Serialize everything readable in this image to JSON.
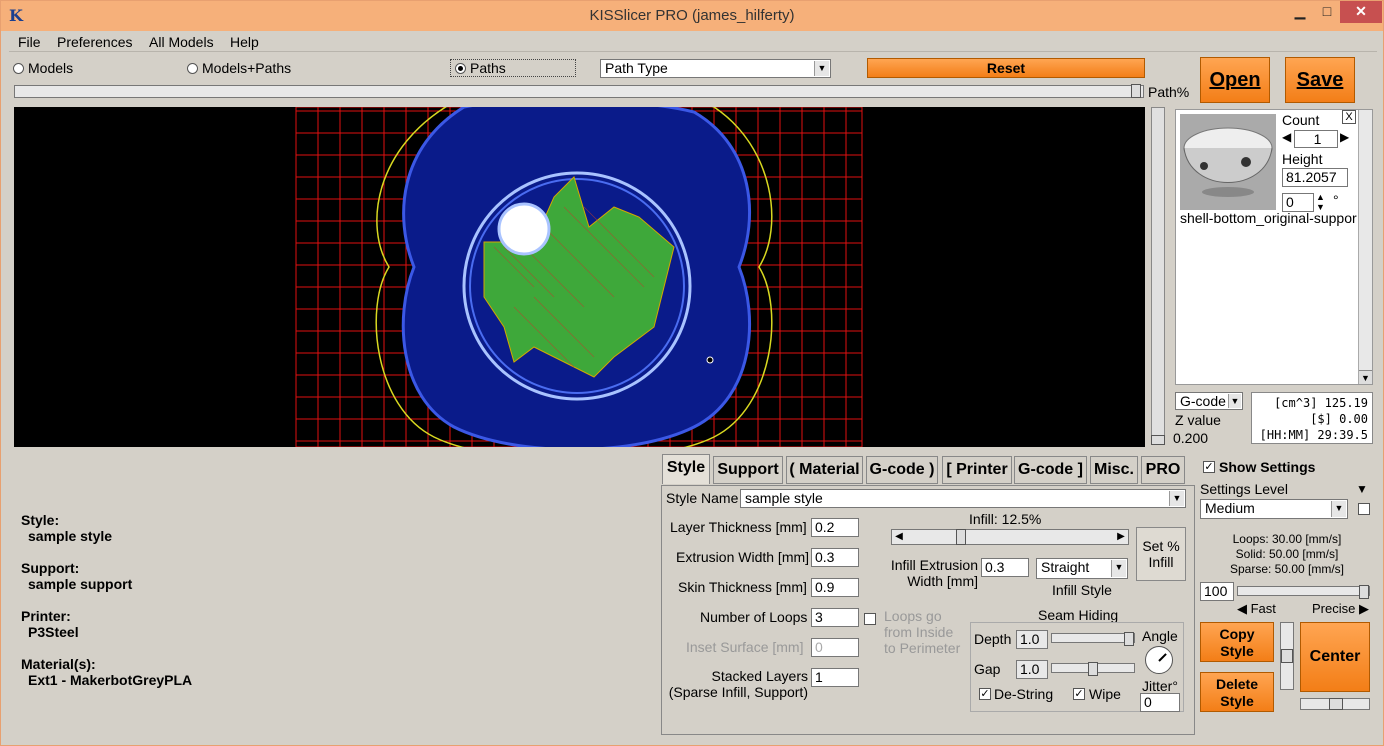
{
  "window": {
    "title": "KISSlicer PRO (james_hilferty)"
  },
  "menu": [
    "File",
    "Preferences",
    "All Models",
    "Help"
  ],
  "view_modes": {
    "models": "Models",
    "models_paths": "Models+Paths",
    "paths": "Paths",
    "selected": "Paths"
  },
  "path_type": "Path Type",
  "reset_label": "Reset",
  "open_label": "Open",
  "save_label": "Save",
  "path_pct_label": "Path%",
  "model_panel": {
    "count_label": "Count",
    "count_value": "1",
    "height_label": "Height",
    "height_value": "81.2057",
    "rotation_value": "0",
    "degree_symbol": "°",
    "model_name": "shell-bottom_original-suppor",
    "close_label": "X"
  },
  "gcode_select": "G-code",
  "z_label": "Z value",
  "z_value": "0.200",
  "stats": {
    "volume": "[cm^3] 125.19",
    "cost": "[$] 0.00",
    "time": "[HH:MM] 29:39.5"
  },
  "tabs": [
    "Style",
    "Support",
    "( Material",
    "G-code )",
    "[ Printer",
    "G-code ]",
    "Misc.",
    "PRO"
  ],
  "style_tab": {
    "style_name_label": "Style Name",
    "style_name_value": "sample style",
    "layer_thickness_label": "Layer Thickness [mm]",
    "layer_thickness_value": "0.2",
    "extrusion_width_label": "Extrusion Width [mm]",
    "extrusion_width_value": "0.3",
    "skin_thickness_label": "Skin Thickness [mm]",
    "skin_thickness_value": "0.9",
    "loops_label": "Number of Loops",
    "loops_value": "3",
    "loops_inside_label_1": "Loops go",
    "loops_inside_label_2": "from Inside",
    "loops_inside_label_3": "to Perimeter",
    "inset_label": "Inset  Surface [mm]",
    "inset_value": "0",
    "stacked_label_1": "Stacked Layers",
    "stacked_label_2": "(Sparse Infill, Support)",
    "stacked_value": "1",
    "infill_label": "Infill: 12.5%",
    "infill_fraction": 0.125,
    "set_infill_label_1": "Set %",
    "set_infill_label_2": "Infill",
    "infill_ext_label_1": "Infill Extrusion",
    "infill_ext_label_2": "Width [mm]",
    "infill_ext_value": "0.3",
    "infill_style_value": "Straight",
    "infill_style_label": "Infill Style",
    "seam_label": "Seam Hiding",
    "depth_label": "Depth",
    "depth_value": "1.0",
    "gap_label": "Gap",
    "gap_value": "1.0",
    "angle_label": "Angle",
    "jitter_label": "Jitter°",
    "jitter_value": "0",
    "destring_label": "De-String",
    "wipe_label": "Wipe"
  },
  "show_settings_label": "Show Settings",
  "settings_level_label": "Settings Level",
  "settings_level_value": "Medium",
  "speeds": {
    "loops": "Loops:  30.00 [mm/s]",
    "solid": "Solid:  50.00 [mm/s]",
    "sparse": "Sparse: 50.00 [mm/s]"
  },
  "speed_value": "100",
  "fast_label": "Fast",
  "precise_label": "Precise",
  "copy_style_1": "Copy",
  "copy_style_2": "Style",
  "delete_style_1": "Delete",
  "delete_style_2": "Style",
  "center_label": "Center",
  "summary": {
    "style_label": "Style:",
    "style_value": "sample style",
    "support_label": "Support:",
    "support_value": "sample support",
    "printer_label": "Printer:",
    "printer_value": "P3Steel",
    "material_label": "Material(s):",
    "material_value": "Ext1 - MakerbotGreyPLA"
  },
  "colors": {
    "accent": "#f37e17",
    "titlebar": "#f6b07a",
    "viewport": "#000000",
    "grid": "#e01010",
    "model": "#0a1b8a",
    "infill": "#3ea83a"
  }
}
